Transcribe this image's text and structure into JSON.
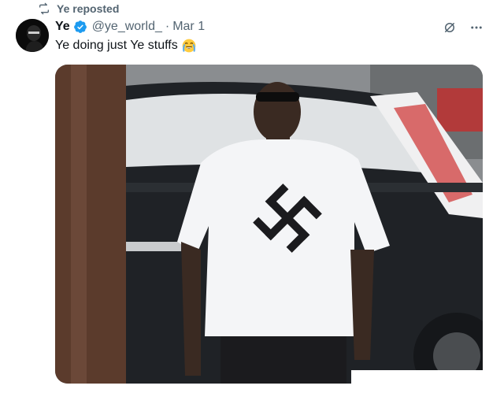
{
  "repost": {
    "label": "Ye reposted"
  },
  "post": {
    "name": "Ye",
    "handle": "@ye_world_",
    "separator": "·",
    "date": "Mar 1",
    "text": "Ye doing just Ye stuffs",
    "emoji": "face-with-tears-emoji"
  },
  "media": {
    "shirt_symbol": "swastika"
  },
  "colors": {
    "verified": "#1d9bf0",
    "muted": "#536471",
    "text": "#0f1419"
  }
}
